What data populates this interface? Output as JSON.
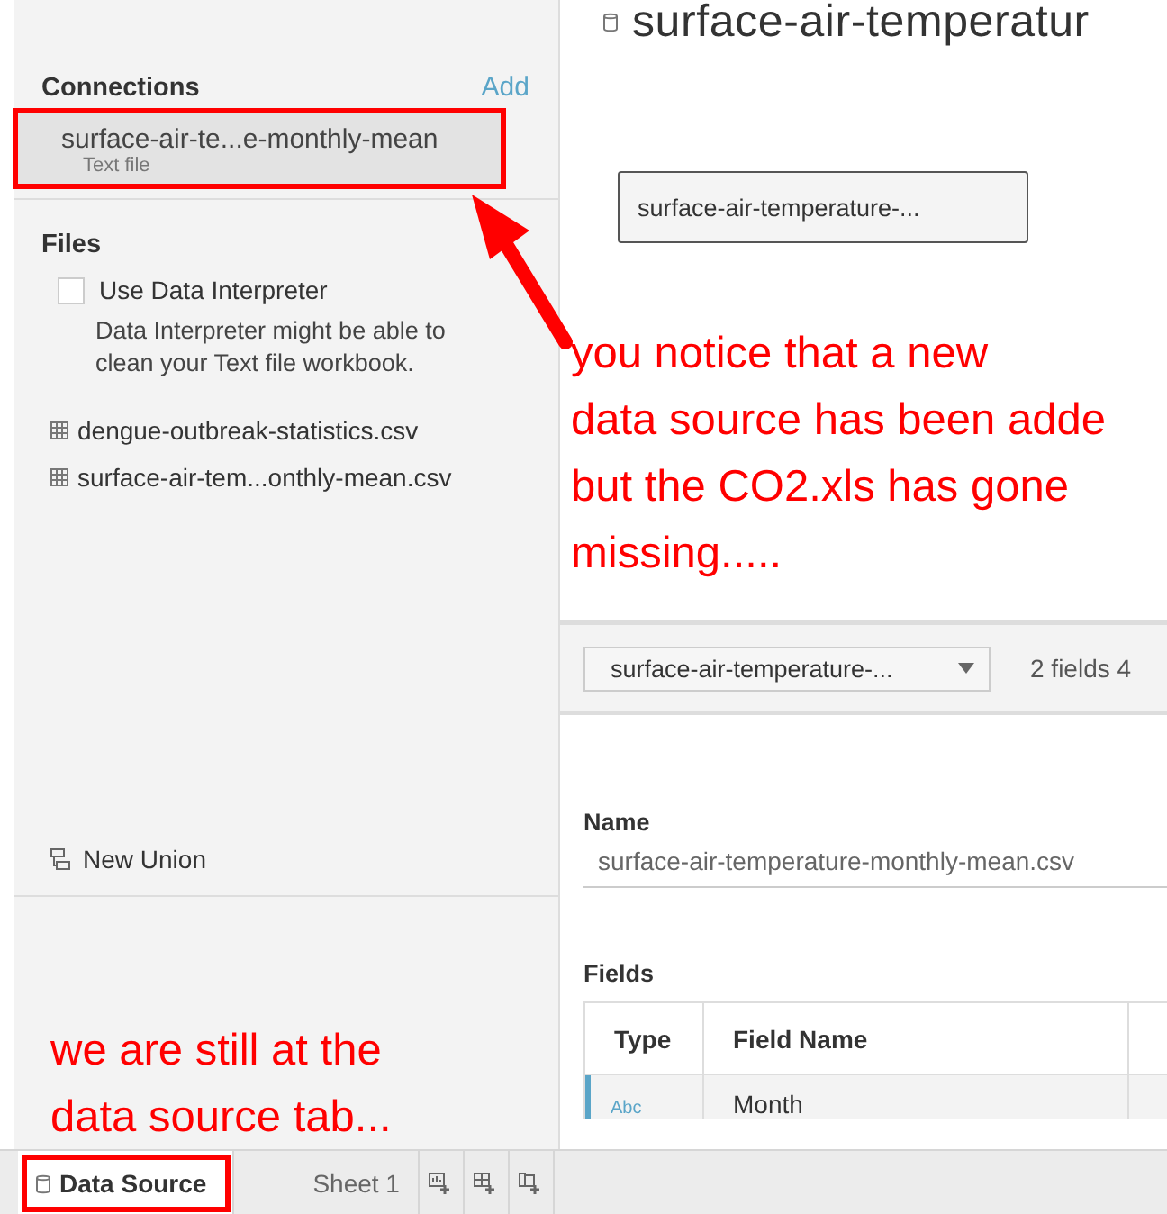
{
  "header": {
    "title": "surface-air-temperatur"
  },
  "sidebar": {
    "connections": {
      "heading": "Connections",
      "add_label": "Add",
      "items": [
        {
          "name": "surface-air-te...e-monthly-mean",
          "type": "Text file",
          "selected": true,
          "highlighted": true
        }
      ]
    },
    "files": {
      "heading": "Files",
      "interpreter": {
        "label": "Use Data Interpreter",
        "checked": false,
        "description": "Data Interpreter might be able to clean your Text file workbook."
      },
      "items": [
        "dengue-outbreak-statistics.csv",
        "surface-air-tem...onthly-mean.csv"
      ],
      "new_union": "New Union"
    }
  },
  "canvas": {
    "table_box": "surface-air-temperature-..."
  },
  "metadata": {
    "table_select": "surface-air-temperature-...",
    "summary": "2 fields 4",
    "name_label": "Name",
    "name_value": "surface-air-temperature-monthly-mean.csv",
    "fields_label": "Fields",
    "columns": [
      "Type",
      "Field Name"
    ],
    "rows": [
      {
        "type": "Abc",
        "field_name": "Month",
        "selected": true
      }
    ]
  },
  "tabs": [
    {
      "label": "Data Source",
      "kind": "datasource",
      "selected": true,
      "highlighted": true
    },
    {
      "label": "Sheet 1",
      "kind": "sheet",
      "selected": false,
      "highlighted": false
    }
  ],
  "annotations": [
    {
      "kind": "right",
      "lines": [
        "you notice that a new",
        "data source has been adde",
        "but the CO2.xls has gone",
        "missing....."
      ]
    },
    {
      "kind": "left",
      "lines": [
        "we are still at the",
        "data source tab..."
      ]
    }
  ]
}
